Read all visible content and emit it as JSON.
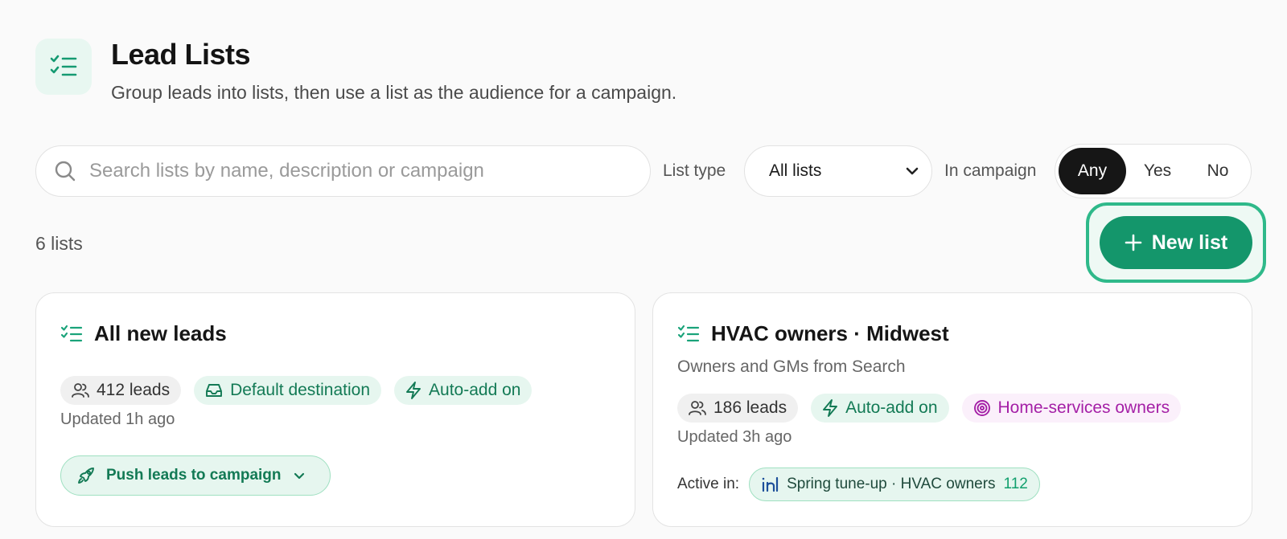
{
  "header": {
    "title": "Lead Lists",
    "subtitle": "Group leads into lists, then use a list as the audience for a campaign.",
    "icon": "list-check-icon"
  },
  "toolbar": {
    "search_placeholder": "Search lists by name, description or campaign",
    "search_value": "",
    "list_type_label": "List type",
    "list_type_selected": "All lists",
    "in_campaign_label": "In campaign",
    "in_campaign_options": [
      "Any",
      "Yes",
      "No"
    ],
    "in_campaign_selected": "Any",
    "new_list_label": "New list"
  },
  "list_count": "6 lists",
  "colors": {
    "accent": "#14966b",
    "accent_light": "#e6f6ef",
    "pink": "#a41fa6"
  },
  "cards": [
    {
      "title": "All new leads",
      "description": "",
      "chips": [
        {
          "label": "412 leads",
          "icon": "users-icon",
          "style": "gray"
        },
        {
          "label": "Default destination",
          "icon": "inbox-icon",
          "style": "green"
        },
        {
          "label": "Auto-add on",
          "icon": "lightning-icon",
          "style": "green"
        }
      ],
      "updated": "Updated 1h ago",
      "push_label": "Push leads to campaign"
    },
    {
      "title": "HVAC owners · Midwest",
      "description": "Owners and GMs from Search",
      "chips": [
        {
          "label": "186 leads",
          "icon": "users-icon",
          "style": "gray"
        },
        {
          "label": "Auto-add on",
          "icon": "lightning-icon",
          "style": "green"
        },
        {
          "label": "Home-services owners",
          "icon": "target-icon",
          "style": "pink"
        }
      ],
      "updated": "Updated 3h ago",
      "active_in_label": "Active in:",
      "campaign": {
        "name": "Spring tune-up · HVAC owners",
        "count": "112",
        "icon": "linkedin-icon"
      }
    }
  ]
}
